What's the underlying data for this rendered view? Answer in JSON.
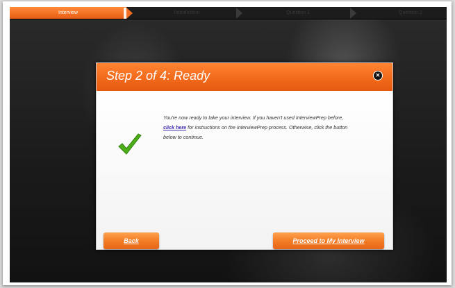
{
  "steps": [
    {
      "label": "Interview",
      "active": true
    },
    {
      "label": "Introduction",
      "active": false
    },
    {
      "label": "Question 1",
      "active": false
    },
    {
      "label": "Question 2",
      "active": false
    }
  ],
  "modal": {
    "title": "Step 2 of 4: Ready",
    "close_icon": "close-icon",
    "message_part1": "You're now ready to take your interview. If you haven't used InterviewPrep before, ",
    "message_link": "click here",
    "message_part2": " for instructions on the InterviewPrep process. Otherwise, click the button below to continue.",
    "back_label": "Back",
    "proceed_label": "Proceed to My Interview"
  },
  "colors": {
    "accent": "#f26d21",
    "check": "#4caf1a"
  }
}
